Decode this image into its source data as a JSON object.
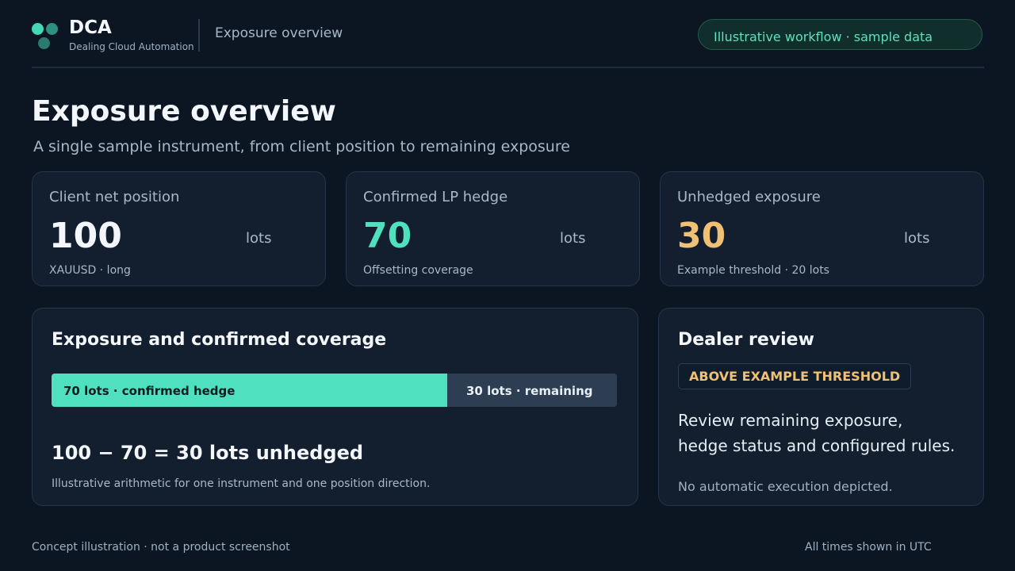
{
  "header": {
    "brand_name": "DCA",
    "brand_sub": "Dealing Cloud Automation",
    "crumb": "Exposure overview",
    "pill": "Illustrative workflow · sample data"
  },
  "page": {
    "title": "Exposure overview",
    "subtitle": "A single sample instrument, from client position to remaining exposure"
  },
  "stats": [
    {
      "label": "Client net position",
      "value": "100",
      "unit": "lots",
      "note": "XAUUSD · long",
      "color": "#f3f7fb"
    },
    {
      "label": "Confirmed LP hedge",
      "value": "70",
      "unit": "lots",
      "note": "Offsetting coverage",
      "color": "#4fe0bf"
    },
    {
      "label": "Unhedged exposure",
      "value": "30",
      "unit": "lots",
      "note": "Example threshold · 20 lots",
      "color": "#f0c074"
    }
  ],
  "coverage": {
    "title": "Exposure and confirmed coverage",
    "hedged_lots": 70,
    "total_lots": 100,
    "hedged_label": "70 lots · confirmed hedge",
    "remaining_label": "30 lots · remaining",
    "formula": "100 − 70 = 30 lots unhedged",
    "note": "Illustrative arithmetic for one instrument and one position direction."
  },
  "review": {
    "title": "Dealer review",
    "badge": "ABOVE EXAMPLE THRESHOLD",
    "text_line1": "Review remaining exposure,",
    "text_line2": "hedge status and configured rules.",
    "note": "No automatic execution depicted."
  },
  "footer": {
    "left": "Concept illustration · not a product screenshot",
    "right": "All times shown in UTC"
  },
  "colors": {
    "accent": "#4fe0bf",
    "warning": "#f0c074",
    "background": "#0b1622",
    "card": "#131f2f"
  }
}
